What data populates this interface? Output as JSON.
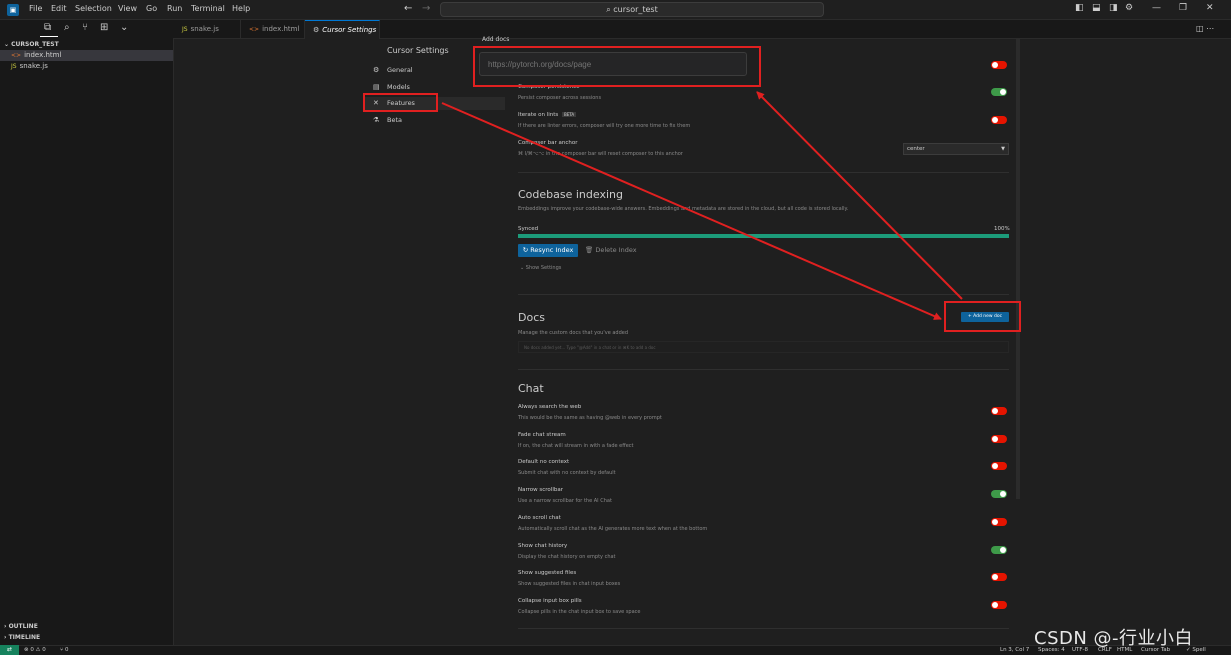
{
  "titlebar": {
    "menu": [
      "File",
      "Edit",
      "Selection",
      "View",
      "Go",
      "Run",
      "Terminal",
      "Help"
    ],
    "search_text": "cursor_test",
    "search_icon": "search-icon"
  },
  "explorer": {
    "folder_name": "CURSOR_TEST",
    "files": [
      {
        "name": "index.html",
        "icon": "html-file-icon"
      },
      {
        "name": "snake.js",
        "icon": "js-file-icon"
      }
    ],
    "outline_label": "OUTLINE",
    "timeline_label": "TIMELINE"
  },
  "tabs": [
    {
      "label": "snake.js"
    },
    {
      "label": "index.html"
    },
    {
      "label": "Cursor Settings",
      "close": "×"
    }
  ],
  "settings": {
    "title": "Cursor Settings",
    "nav": [
      {
        "label": "General",
        "icon": "gear-icon"
      },
      {
        "label": "Models",
        "icon": "box-icon"
      },
      {
        "label": "Features",
        "icon": "wrench-icon"
      },
      {
        "label": "Beta",
        "icon": "flask-icon"
      }
    ],
    "composer_rows": [
      {
        "title": "Composer persistence",
        "desc": "Persist composer across sessions",
        "state": "on"
      },
      {
        "title": "Iterate on lints",
        "badge": "BETA",
        "desc": "If there are linter errors, composer will try one more time to fix them",
        "state": "off"
      },
      {
        "title": "Composer bar anchor",
        "desc": "⌘ I/⌘⌥⌥ in the composer bar will reset composer to this anchor",
        "select": "center"
      }
    ],
    "first_toggle_state": "off",
    "indexing": {
      "title": "Codebase indexing",
      "desc": "Embeddings improve your codebase-wide answers. Embeddings and metadata are stored in the cloud, but all code is stored locally.",
      "status": "Synced",
      "percent_text": "100%",
      "progress": 1.0,
      "resync_label": "↻ Resync Index",
      "delete_label": "🗑 Delete Index",
      "show_settings": "⌄ Show Settings"
    },
    "docs": {
      "title": "Docs",
      "desc": "Manage the custom docs that you've added",
      "add_label": "+ Add new doc",
      "empty_text": "No docs added yet... Type \"@Add\" in a chat or in ⌘K to add a doc"
    },
    "chat": {
      "title": "Chat",
      "rows": [
        {
          "title": "Always search the web",
          "desc": "This would be the same as having @web in every prompt",
          "state": "off"
        },
        {
          "title": "Fade chat stream",
          "desc": "If on, the chat will stream in with a fade effect",
          "state": "off"
        },
        {
          "title": "Default no context",
          "desc": "Submit chat with no context by default",
          "state": "off"
        },
        {
          "title": "Narrow scrollbar",
          "desc": "Use a narrow scrollbar for the AI Chat",
          "state": "on"
        },
        {
          "title": "Auto scroll chat",
          "desc": "Automatically scroll chat as the AI generates more text when at the bottom",
          "state": "off"
        },
        {
          "title": "Show chat history",
          "desc": "Display the chat history on empty chat",
          "state": "on"
        },
        {
          "title": "Show suggested files",
          "desc": "Show suggested files in chat input boxes",
          "state": "off"
        },
        {
          "title": "Collapse input box pills",
          "desc": "Collapse pills in the chat input box to save space",
          "state": "off"
        }
      ]
    }
  },
  "popup": {
    "label": "Add docs",
    "placeholder": "https://pytorch.org/docs/page"
  },
  "statusbar": {
    "remote": "⇄",
    "problems": "⊗ 0 ⚠ 0",
    "ports": "⑂ 0",
    "position": "Ln 3, Col 7",
    "spaces": "Spaces: 4",
    "encoding": "UTF-8",
    "eol": "CRLF",
    "language": "HTML",
    "cursor_tab": "Cursor Tab",
    "spell": "✓ Spell"
  },
  "watermark": "CSDN @-行业小白",
  "colors": {
    "accent": "#0e639c",
    "toggle_off": "#e51400",
    "toggle_on": "#3e9a49",
    "annotation": "#e02020",
    "synced": "#1c9b7a"
  }
}
